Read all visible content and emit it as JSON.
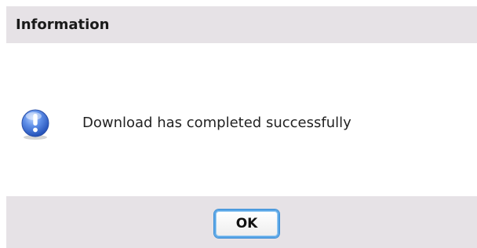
{
  "dialog": {
    "title": "Information",
    "message": "Download has completed successfully",
    "icon": "info-exclamation-icon",
    "ok_label": "OK"
  },
  "colors": {
    "bar_background": "#e6e2e6",
    "icon_blue": "#3f72d8",
    "button_focus_border": "#5aa6e6"
  }
}
